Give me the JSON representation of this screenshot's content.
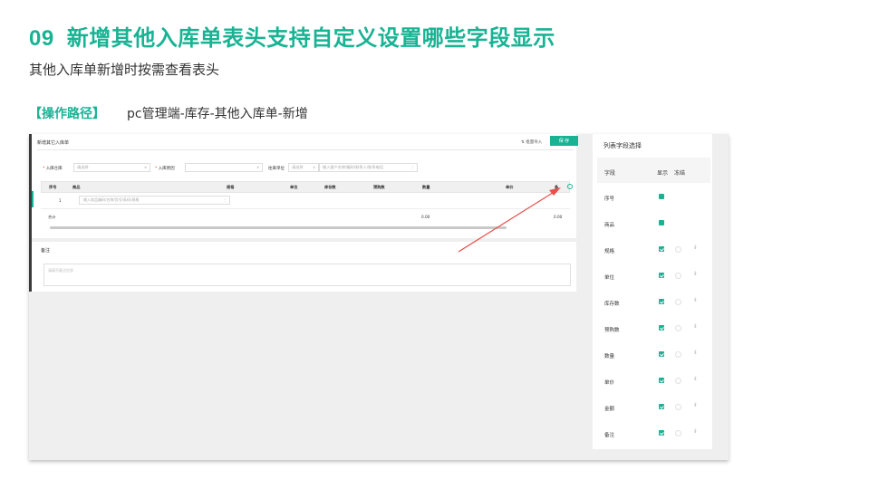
{
  "slide": {
    "number": "09",
    "title": "新增其他入库单表头支持自定义设置哪些字段显示",
    "subtitle": "其他入库单新增时按需查看表头",
    "path_label": "【操作路径】",
    "path_value": "pc管理端-库存-其他入库单-新增"
  },
  "form": {
    "title": "新增其它入库单",
    "batch_import": "批量导入",
    "save": "保 存",
    "warehouse_label": "入库仓库",
    "warehouse_placeholder": "请选择",
    "reason_label": "入库原因",
    "unit_label": "往来单位",
    "unit_placeholder": "请选择",
    "unit_search_placeholder": "输入客户名称/编码/联系人/联系电话"
  },
  "table": {
    "headers": [
      "序号",
      "商品",
      "规格",
      "单位",
      "库存数",
      "预购数",
      "数量",
      "单价",
      "备"
    ],
    "row": {
      "num": "1",
      "input_placeholder": "输入商品编码/名称/货号/条码/规格"
    },
    "sum_label": "合计",
    "sum_qty": "0.00",
    "sum_amount": "0.00"
  },
  "remark": {
    "title": "备注",
    "placeholder": "请填写备注信息"
  },
  "column_panel": {
    "title": "列表字段选择",
    "head_field": "字段",
    "head_show": "显示",
    "head_freeze": "冻结",
    "rows": [
      {
        "name": "序号",
        "checked": true,
        "freeze": false,
        "draggable": false
      },
      {
        "name": "商品",
        "checked": true,
        "freeze": false,
        "draggable": false
      },
      {
        "name": "规格",
        "checked": true,
        "freeze": true,
        "draggable": true
      },
      {
        "name": "单位",
        "checked": true,
        "freeze": true,
        "draggable": true
      },
      {
        "name": "库存数",
        "checked": true,
        "freeze": true,
        "draggable": true
      },
      {
        "name": "预购数",
        "checked": true,
        "freeze": true,
        "draggable": true
      },
      {
        "name": "数量",
        "checked": true,
        "freeze": true,
        "draggable": true
      },
      {
        "name": "单价",
        "checked": true,
        "freeze": true,
        "draggable": true
      },
      {
        "name": "金额",
        "checked": true,
        "freeze": true,
        "draggable": true
      },
      {
        "name": "备注",
        "checked": true,
        "freeze": true,
        "draggable": true
      }
    ]
  },
  "colors": {
    "accent": "#19b394",
    "arrow": "#e8504a"
  }
}
